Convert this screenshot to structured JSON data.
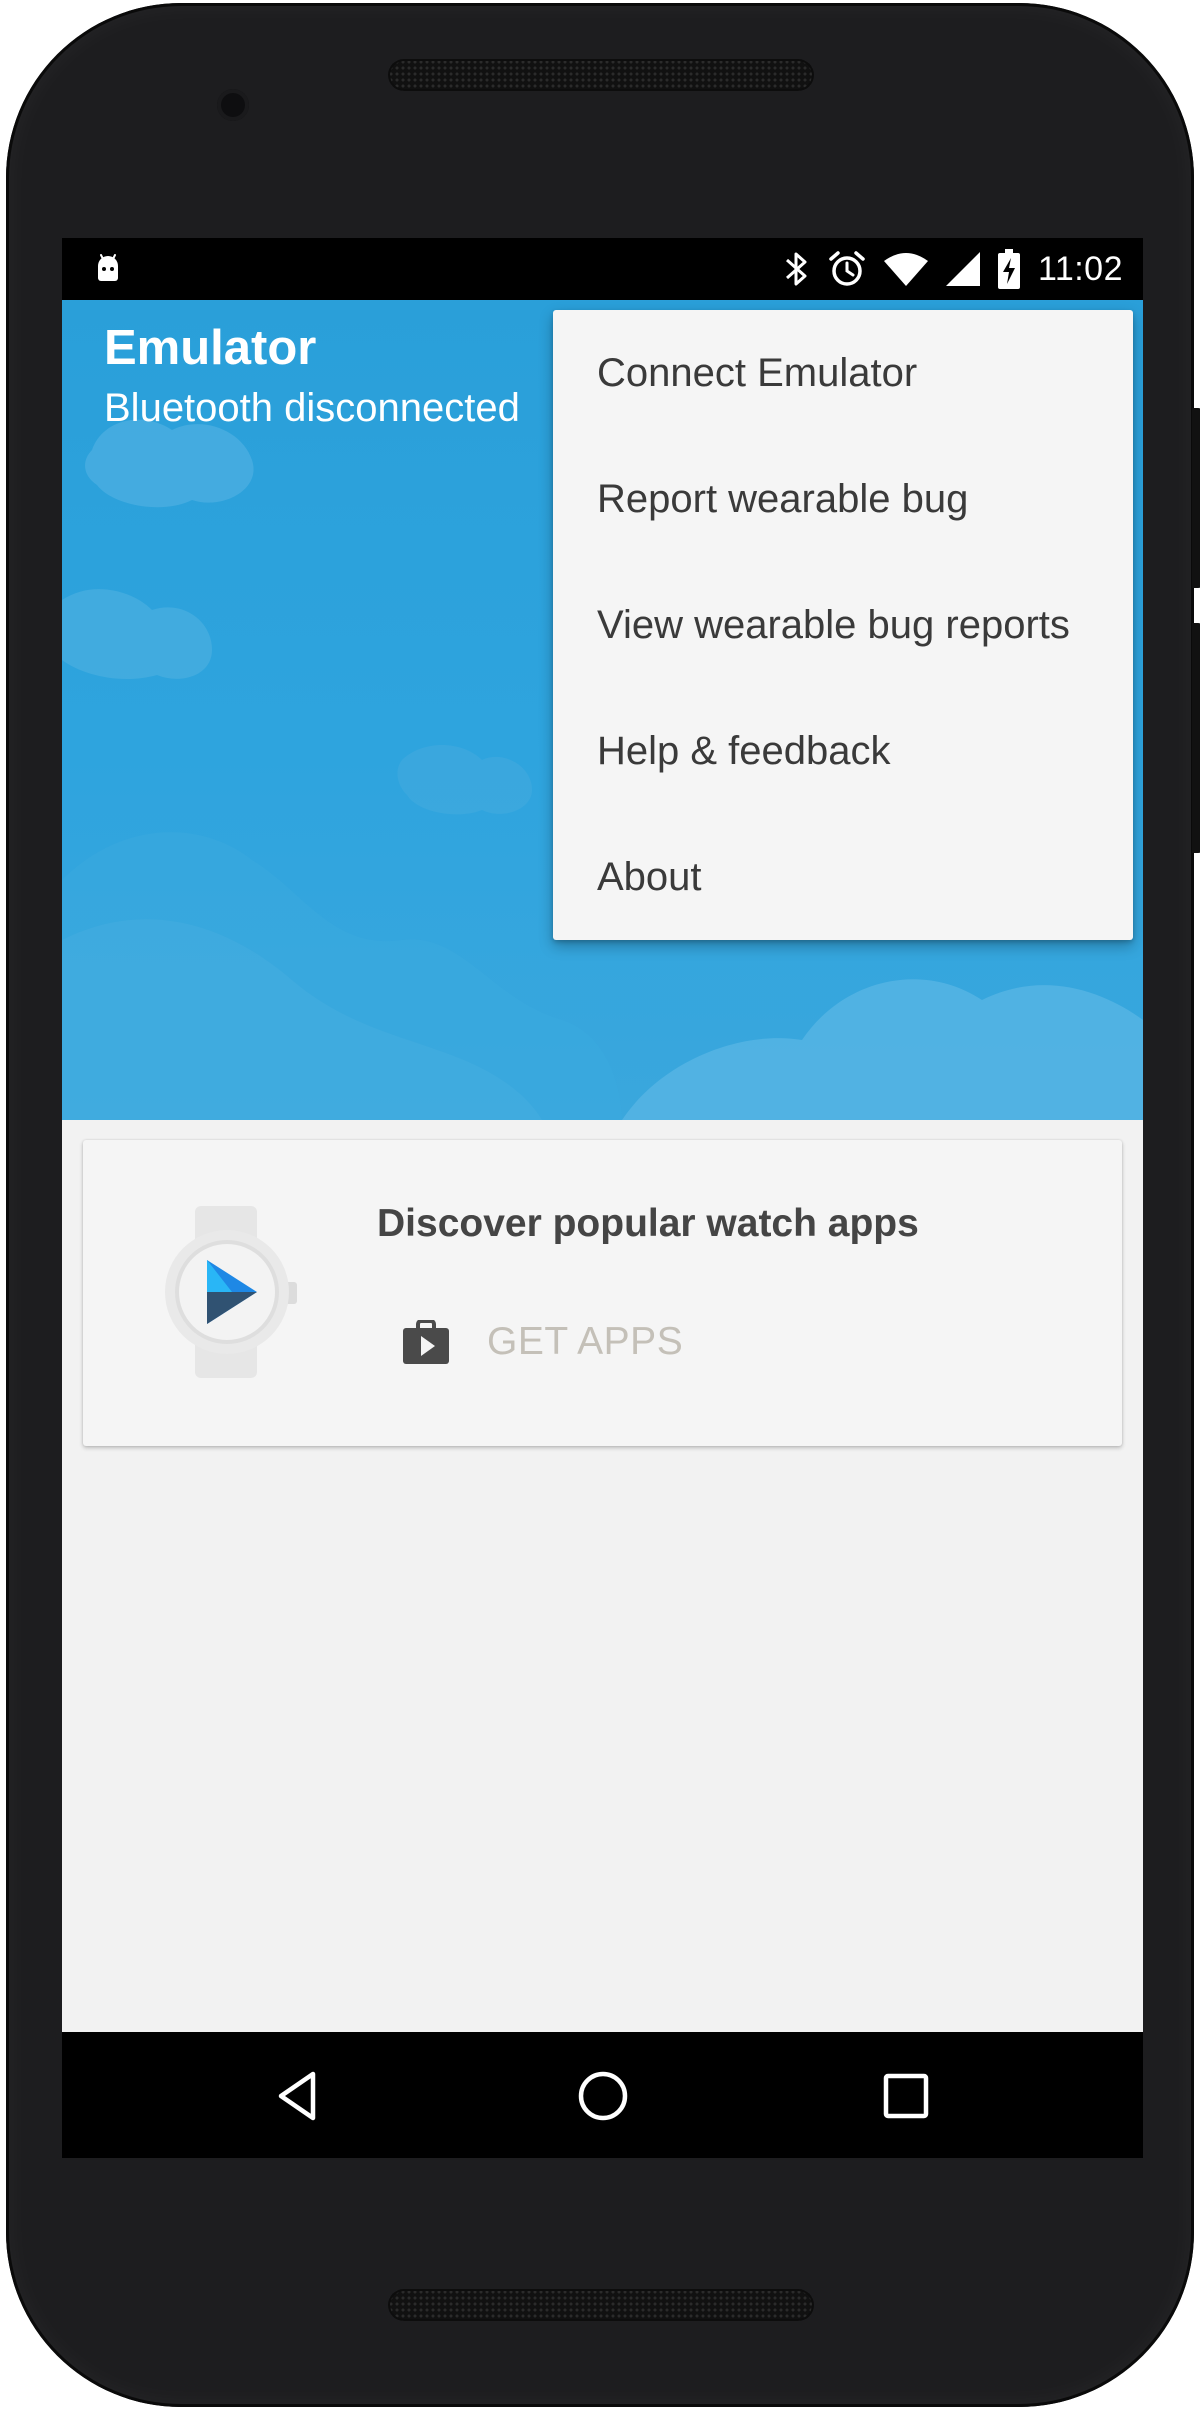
{
  "status_bar": {
    "time": "11:02",
    "icons": [
      "android-icon",
      "bluetooth-icon",
      "alarm-icon",
      "wifi-icon",
      "signal-icon",
      "battery-charging-icon"
    ]
  },
  "header": {
    "title": "Emulator",
    "subtitle": "Bluetooth disconnected"
  },
  "menu": {
    "items": [
      {
        "label": "Connect Emulator"
      },
      {
        "label": "Report wearable bug"
      },
      {
        "label": "View wearable bug reports"
      },
      {
        "label": "Help & feedback"
      },
      {
        "label": "About"
      }
    ]
  },
  "card": {
    "title": "Discover popular watch apps",
    "action_label": "GET APPS",
    "icons": [
      "watch-play-icon",
      "play-store-bag-icon"
    ]
  },
  "nav_bar": {
    "icons": [
      "back-icon",
      "home-icon",
      "recents-icon"
    ]
  },
  "colors": {
    "hero_blue": "#2ea4de",
    "menu_bg": "#f5f5f5",
    "menu_text": "#3a3a3a",
    "action_text": "#c4c0b8"
  }
}
